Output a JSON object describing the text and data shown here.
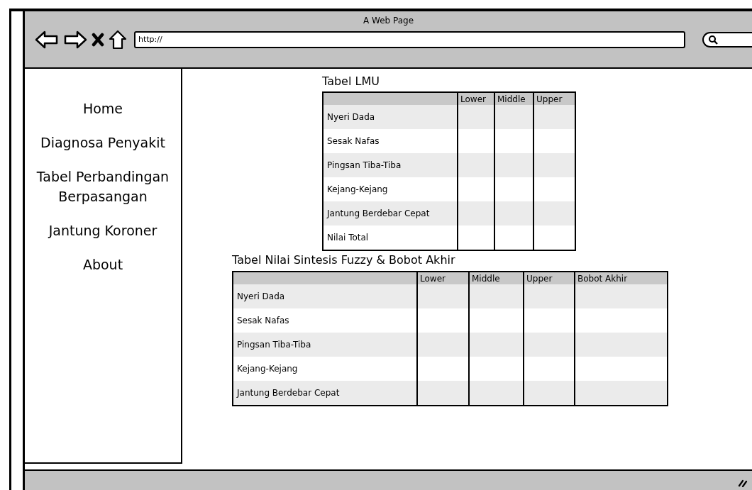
{
  "window": {
    "title": "A Web Page"
  },
  "address_bar": {
    "value": "http://"
  },
  "sidebar": {
    "items": [
      {
        "label": "Home"
      },
      {
        "label": "Diagnosa Penyakit"
      },
      {
        "label": "Tabel Perbandingan Berpasangan"
      },
      {
        "label": "Jantung Koroner"
      },
      {
        "label": "About"
      }
    ]
  },
  "tables": [
    {
      "title": "Tabel LMU",
      "columns": [
        "Lower",
        "Middle",
        "Upper"
      ],
      "rows": [
        "Nyeri Dada",
        "Sesak Nafas",
        "Pingsan Tiba-Tiba",
        "Kejang-Kejang",
        "Jantung Berdebar Cepat",
        "Nilai Total"
      ]
    },
    {
      "title": "Tabel Nilai Sintesis Fuzzy & Bobot Akhir",
      "columns": [
        "Lower",
        "Middle",
        "Upper",
        "Bobot Akhir"
      ],
      "rows": [
        "Nyeri Dada",
        "Sesak Nafas",
        "Pingsan Tiba-Tiba",
        "Kejang-Kejang",
        "Jantung Berdebar Cepat"
      ]
    }
  ]
}
